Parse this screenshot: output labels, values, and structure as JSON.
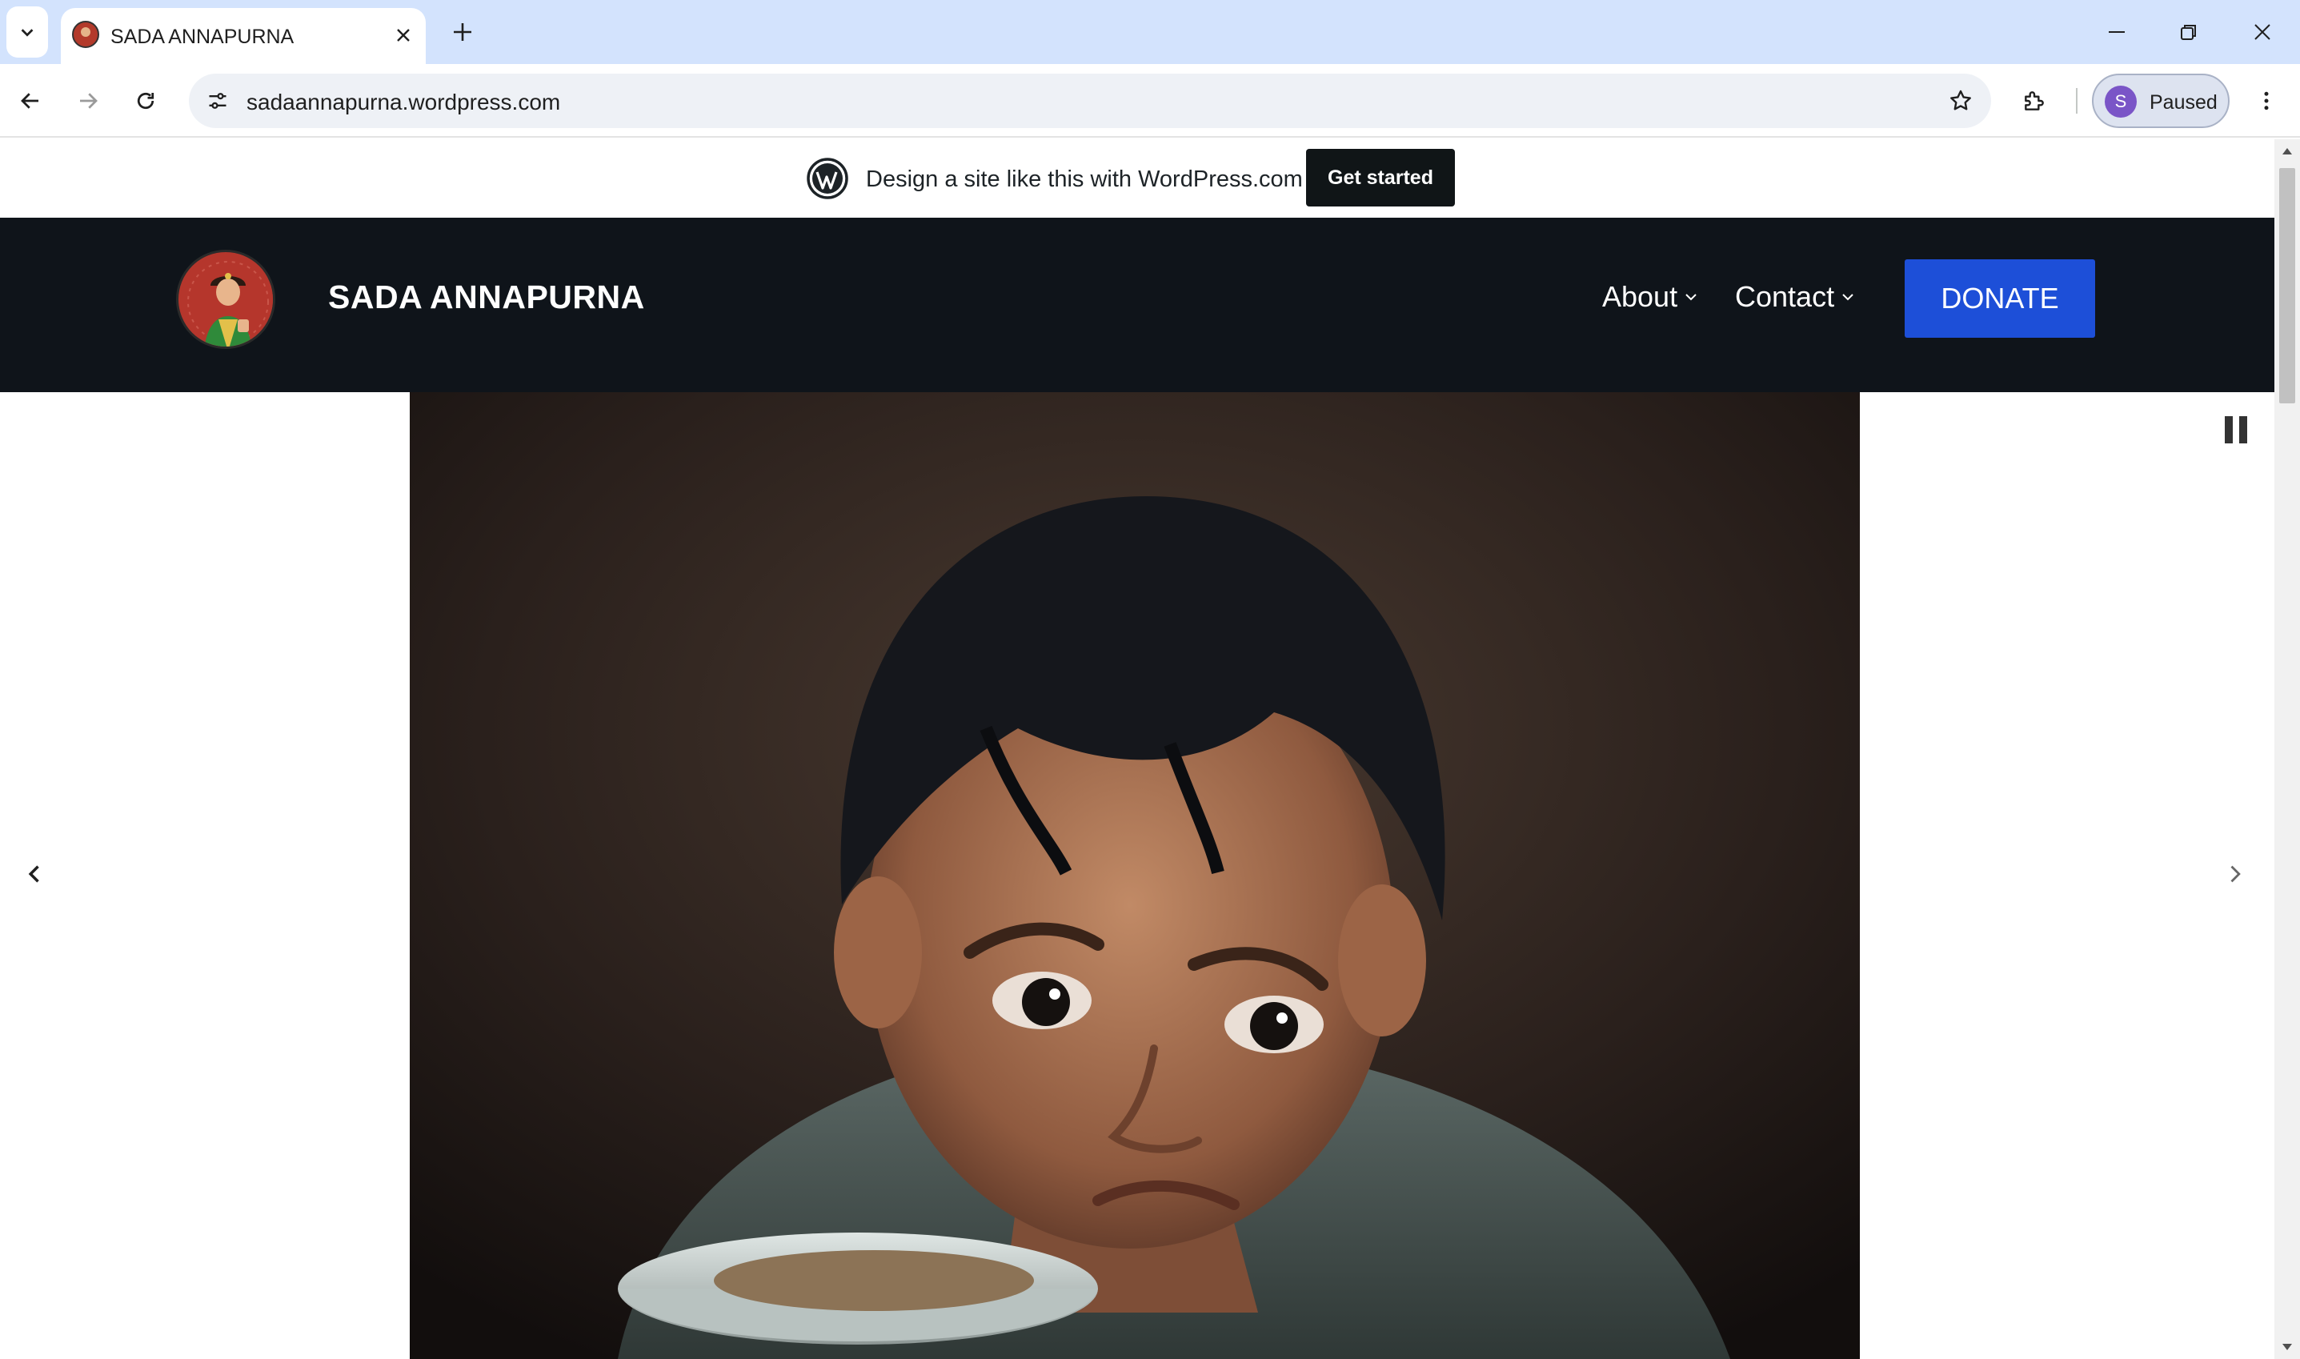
{
  "browser": {
    "tab_title": "SADA ANNAPURNA",
    "url": "sadaannapurna.wordpress.com",
    "profile_initial": "S",
    "profile_status": "Paused"
  },
  "wp_banner": {
    "text": "Design a site like this with WordPress.com",
    "cta": "Get started"
  },
  "site": {
    "title": "SADA ANNAPURNA",
    "nav": [
      "About",
      "Contact"
    ],
    "donate": "DONATE"
  },
  "colors": {
    "tabstrip": "#d3e3fd",
    "header_bg": "#0f141a",
    "donate_bg": "#1d4fd8",
    "cta_bg": "#101517"
  }
}
